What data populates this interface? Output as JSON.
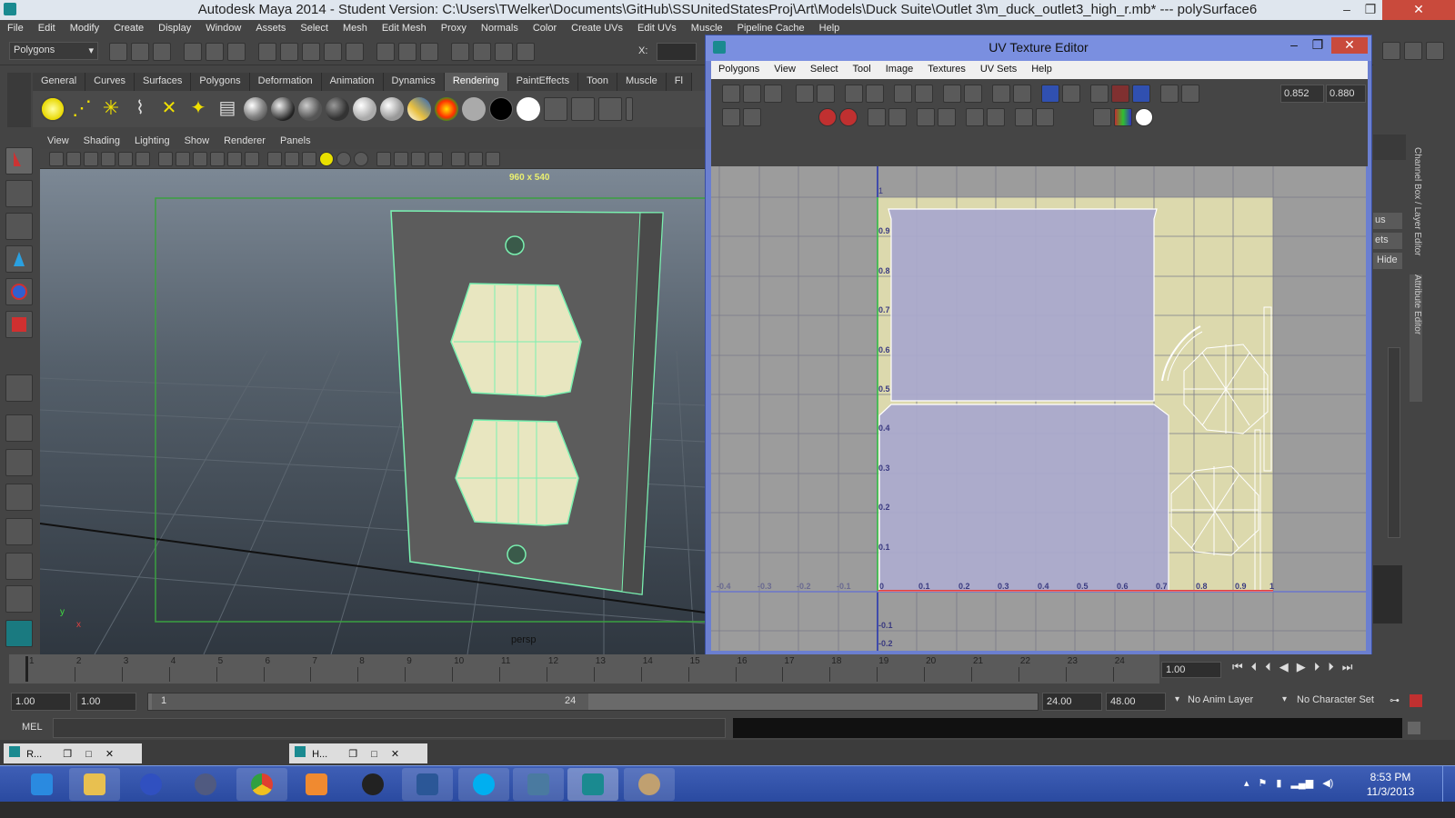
{
  "window": {
    "title": "Autodesk Maya 2014 - Student Version: C:\\Users\\TWelker\\Documents\\GitHub\\SSUnitedStatesProj\\Art\\Models\\Duck Suite\\Outlet 3\\m_duck_outlet3_high_r.mb*   ---   polySurface6",
    "minimize": "–",
    "maximize": "❐",
    "close": "✕"
  },
  "menubar": [
    "File",
    "Edit",
    "Modify",
    "Create",
    "Display",
    "Window",
    "Assets",
    "Select",
    "Mesh",
    "Edit Mesh",
    "Proxy",
    "Normals",
    "Color",
    "Create UVs",
    "Edit UVs",
    "Muscle",
    "Pipeline Cache",
    "Help"
  ],
  "statusline": {
    "mode": "Polygons",
    "xlabel": "X:"
  },
  "shelf_tabs": [
    "General",
    "Curves",
    "Surfaces",
    "Polygons",
    "Deformation",
    "Animation",
    "Dynamics",
    "Rendering",
    "PaintEffects",
    "Toon",
    "Muscle",
    "Fl"
  ],
  "shelf_active": "Rendering",
  "viewport": {
    "menu": [
      "View",
      "Shading",
      "Lighting",
      "Show",
      "Renderer",
      "Panels"
    ],
    "resolution": "960 x 540",
    "camera": "persp",
    "axis_y": "y",
    "axis_x": "x"
  },
  "uv_editor": {
    "title": "UV Texture Editor",
    "menu": [
      "Polygons",
      "View",
      "Select",
      "Tool",
      "Image",
      "Textures",
      "UV Sets",
      "Help"
    ],
    "field_u": "0.852",
    "field_v": "0.880",
    "top_label": "1",
    "x_ticks": [
      "-0.4",
      "-0.3",
      "-0.2",
      "-0.1",
      "0",
      "0.1",
      "0.2",
      "0.3",
      "0.4",
      "0.5",
      "0.6",
      "0.7",
      "0.8",
      "0.9",
      "1"
    ],
    "y_ticks": [
      "0.9",
      "0.8",
      "0.7",
      "0.6",
      "0.5",
      "0.4",
      "0.3",
      "0.2",
      "0.1",
      "-0.1",
      "-0.2"
    ],
    "colors": {
      "shell": "#a9a9cc",
      "texture": "#dcd9ad",
      "grid_bg": "#9c9c9c",
      "blue_axis": "#2030b0",
      "red_axis": "#e04040",
      "green_axis": "#40d040"
    }
  },
  "right_panel": {
    "tabs": [
      "Channel Box / Layer Editor",
      "Attribute Editor"
    ],
    "labels": [
      "us",
      "ets",
      "Hide"
    ]
  },
  "timeline": {
    "ticks": [
      "1",
      "2",
      "3",
      "4",
      "5",
      "6",
      "7",
      "8",
      "9",
      "10",
      "11",
      "12",
      "13",
      "14",
      "15",
      "16",
      "17",
      "18",
      "19",
      "20",
      "21",
      "22",
      "23",
      "24"
    ],
    "current": "1.00"
  },
  "range": {
    "start": "1.00",
    "start_inner": "1.00",
    "slider_start": "1",
    "slider_end": "24",
    "end_inner": "24.00",
    "end": "48.00",
    "anim_layer": "No Anim Layer",
    "character_set": "No Character Set"
  },
  "mel": {
    "label": "MEL"
  },
  "minimized": [
    {
      "label": "R..."
    },
    {
      "label": "H..."
    }
  ],
  "taskbar": {
    "time": "8:53 PM",
    "date": "11/3/2013",
    "apps": [
      {
        "name": "internet-explorer",
        "color": "#2a8ae0"
      },
      {
        "name": "file-explorer",
        "color": "#e8c050"
      },
      {
        "name": "help",
        "color": "#3050c0"
      },
      {
        "name": "browser-globe",
        "color": "#505a80"
      },
      {
        "name": "chrome",
        "color": "#e04030"
      },
      {
        "name": "media-player",
        "color": "#f08a30"
      },
      {
        "name": "obs",
        "color": "#222222"
      },
      {
        "name": "word",
        "color": "#2b5797"
      },
      {
        "name": "skype",
        "color": "#00aff0"
      },
      {
        "name": "github",
        "color": "#4a7aa0"
      },
      {
        "name": "maya",
        "color": "#1a8a90"
      },
      {
        "name": "paint",
        "color": "#c0a070"
      }
    ]
  }
}
